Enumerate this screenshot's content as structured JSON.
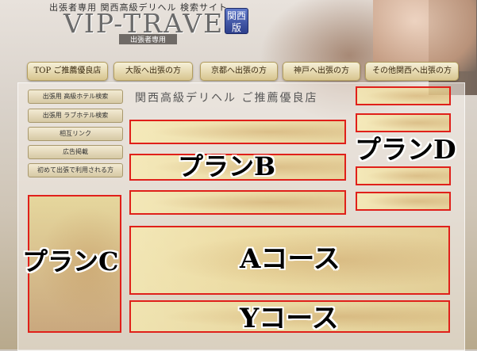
{
  "header": {
    "tagline": "出張者専用 関西高級デリヘル 検索サイト",
    "logo": "VIP-TRAVEL",
    "logo_sub": "出張者専用",
    "seal_line1": "関西",
    "seal_line2": "版"
  },
  "nav": [
    {
      "label": "TOP ご推薦優良店"
    },
    {
      "label": "大阪へ出張の方"
    },
    {
      "label": "京都へ出張の方"
    },
    {
      "label": "神戸へ出張の方"
    },
    {
      "label": "その他関西へ出張の方"
    }
  ],
  "panel_title": "関西高級デリヘル ご推薦優良店",
  "sidebar": [
    {
      "label": "出張用 高級ホテル検索"
    },
    {
      "label": "出張用 ラブホテル検索"
    },
    {
      "label": "相互リンク"
    },
    {
      "label": "広告掲載"
    },
    {
      "label": "初めて出張で利用される方"
    }
  ],
  "plans": {
    "b": "プランB",
    "c": "プランC",
    "d": "プランD",
    "a_course": "Aコース",
    "y_course": "Yコース"
  },
  "colors": {
    "slot_border": "#e0201a",
    "nav_gold": "#d8c58f",
    "seal_blue": "#2d3f8c"
  }
}
